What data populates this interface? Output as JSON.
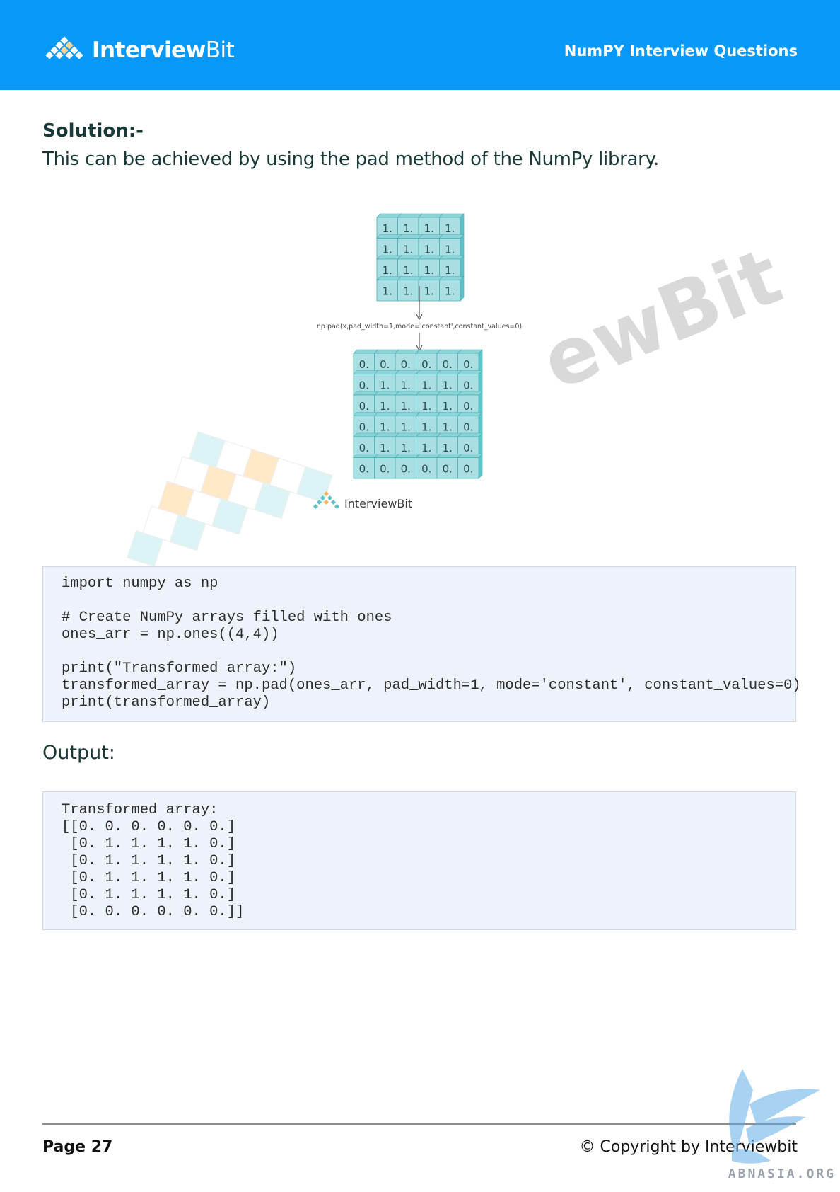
{
  "header": {
    "logo_text_a": "Interview",
    "logo_text_b": "Bit",
    "title": "NumPY Interview Questions"
  },
  "solution": {
    "heading": "Solution:-",
    "text": "This can be achieved by using the pad method of the NumPy library."
  },
  "figure": {
    "input_grid": [
      [
        "1.",
        "1.",
        "1.",
        "1."
      ],
      [
        "1.",
        "1.",
        "1.",
        "1."
      ],
      [
        "1.",
        "1.",
        "1.",
        "1."
      ],
      [
        "1.",
        "1.",
        "1.",
        "1."
      ]
    ],
    "operation_label": "np.pad(x,pad_width=1,mode='constant',constant_values=0)",
    "output_grid": [
      [
        "0.",
        "0.",
        "0.",
        "0.",
        "0.",
        "0."
      ],
      [
        "0.",
        "1.",
        "1.",
        "1.",
        "1.",
        "0."
      ],
      [
        "0.",
        "1.",
        "1.",
        "1.",
        "1.",
        "0."
      ],
      [
        "0.",
        "1.",
        "1.",
        "1.",
        "1.",
        "0."
      ],
      [
        "0.",
        "1.",
        "1.",
        "1.",
        "1.",
        "0."
      ],
      [
        "0.",
        "0.",
        "0.",
        "0.",
        "0.",
        "0."
      ]
    ],
    "logo_text": "InterviewBit",
    "watermark_text": "ewBit"
  },
  "code": {
    "lines": [
      "import numpy as np",
      "",
      "# Create NumPy arrays filled with ones",
      "ones_arr = np.ones((4,4))",
      "",
      "print(\"Transformed array:\")",
      "transformed_array = np.pad(ones_arr, pad_width=1, mode='constant', constant_values=0)",
      "print(transformed_array)"
    ]
  },
  "output": {
    "heading": "Output:",
    "lines": [
      "Transformed array:",
      "[[0. 0. 0. 0. 0. 0.]",
      " [0. 1. 1. 1. 1. 0.]",
      " [0. 1. 1. 1. 1. 0.]",
      " [0. 1. 1. 1. 1. 0.]",
      " [0. 1. 1. 1. 1. 0.]",
      " [0. 0. 0. 0. 0. 0.]]"
    ]
  },
  "footer": {
    "page": "Page 27",
    "copyright": "© Copyright by Interviewbit",
    "corner_text": "ABNASIA.ORG"
  },
  "colors": {
    "header_bg": "#0898f7",
    "cube_face": "#a9dfe2",
    "cube_side": "#5fc4c9",
    "code_bg": "#eef2fa"
  }
}
